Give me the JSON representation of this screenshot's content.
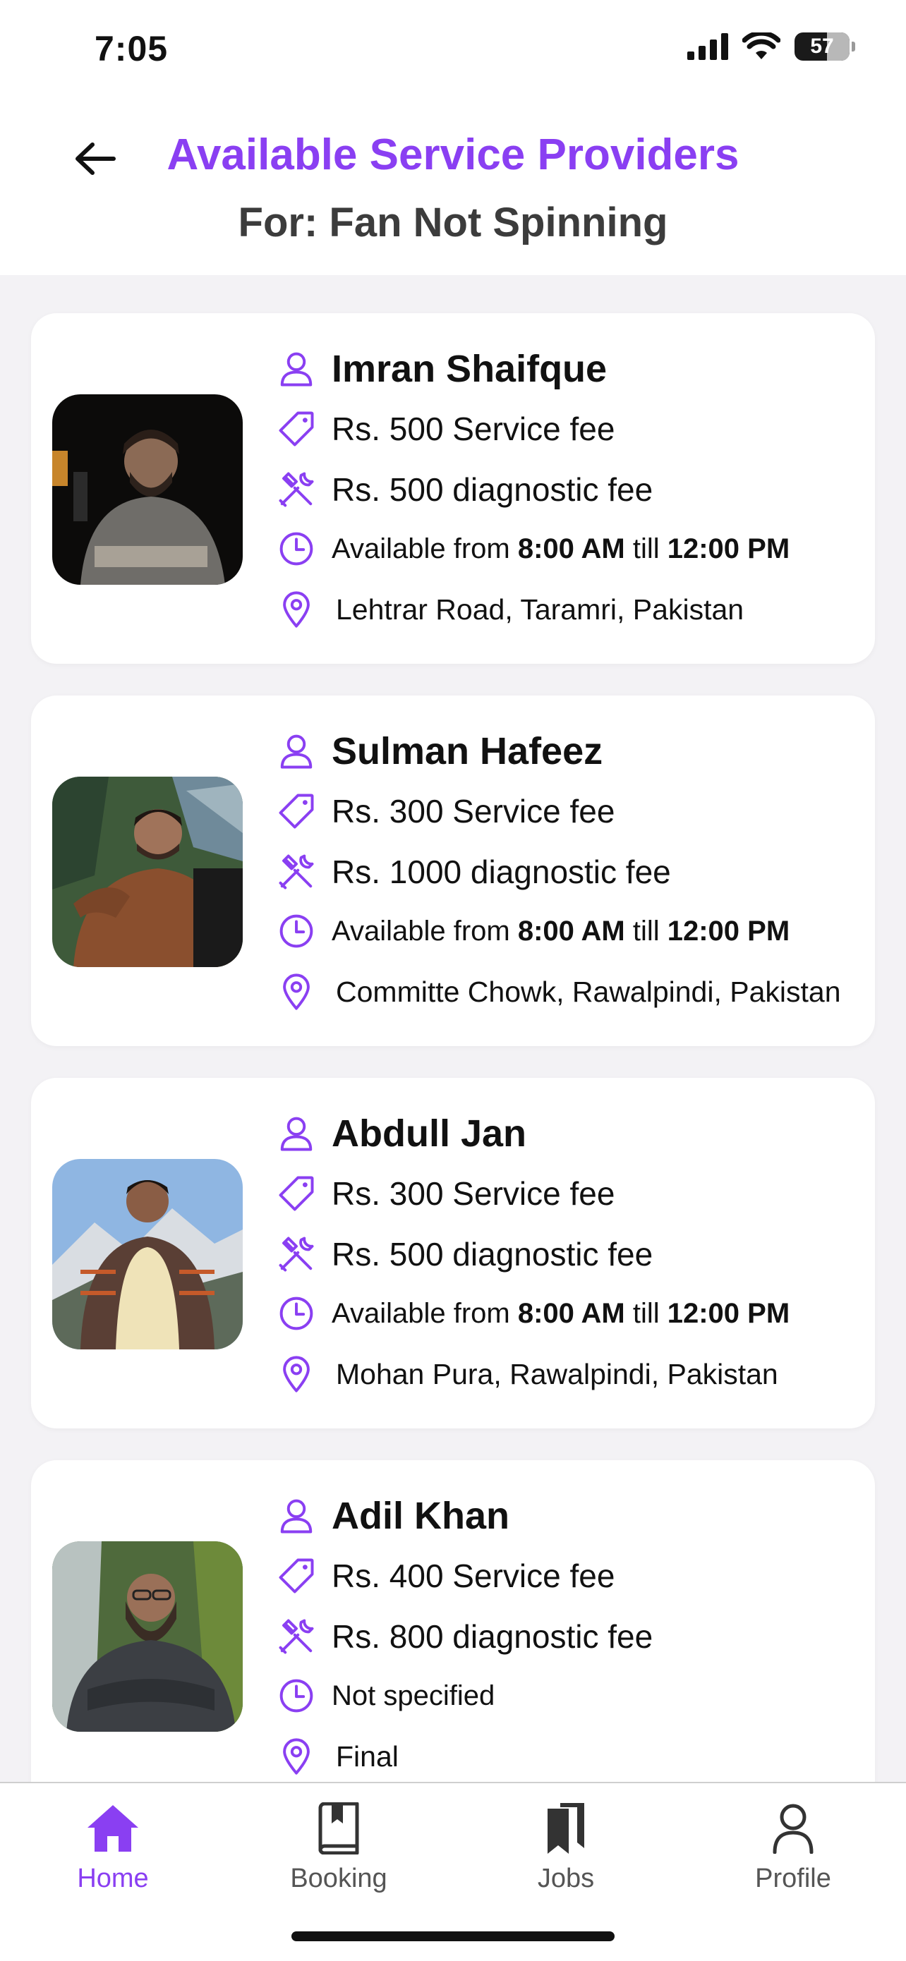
{
  "status_bar": {
    "time": "7:05",
    "battery": "57"
  },
  "header": {
    "title": "Available Service Providers",
    "subtitle": "For: Fan Not Spinning"
  },
  "colors": {
    "accent": "#8a3ff2",
    "background": "#f3f2f5",
    "card": "#ffffff"
  },
  "providers": [
    {
      "name": "Imran Shaifque",
      "service_fee": "Rs. 500 Service fee",
      "diagnostic_fee": "Rs. 500 diagnostic fee",
      "availability": {
        "prefix": "Available from ",
        "start": "8:00 AM",
        "mid": " till ",
        "end": "12:00 PM"
      },
      "location": "Lehtrar Road, Taramri, Pakistan"
    },
    {
      "name": "Sulman Hafeez",
      "service_fee": "Rs. 300 Service fee",
      "diagnostic_fee": "Rs. 1000 diagnostic fee",
      "availability": {
        "prefix": "Available from ",
        "start": "8:00 AM",
        "mid": " till ",
        "end": "12:00 PM"
      },
      "location": "Committe Chowk, Rawalpindi, Pakistan"
    },
    {
      "name": "Abdull Jan",
      "service_fee": "Rs. 300 Service fee",
      "diagnostic_fee": "Rs. 500 diagnostic fee",
      "availability": {
        "prefix": "Available from ",
        "start": "8:00 AM",
        "mid": " till ",
        "end": "12:00 PM"
      },
      "location": "Mohan Pura, Rawalpindi, Pakistan"
    },
    {
      "name": "Adil Khan",
      "service_fee": "Rs. 400 Service fee",
      "diagnostic_fee": "Rs. 800 diagnostic fee",
      "availability": {
        "prefix": "Not specified",
        "start": "",
        "mid": "",
        "end": ""
      },
      "location": "Final"
    }
  ],
  "icons": {
    "name": "person-icon",
    "fee": "tag-icon",
    "diagnostic": "tools-icon",
    "time": "clock-icon",
    "location": "map-pin-icon"
  },
  "tabs": [
    {
      "label": "Home",
      "icon": "home-icon",
      "active": true
    },
    {
      "label": "Booking",
      "icon": "book-icon",
      "active": false
    },
    {
      "label": "Jobs",
      "icon": "bookmarks-icon",
      "active": false
    },
    {
      "label": "Profile",
      "icon": "person-icon",
      "active": false
    }
  ]
}
